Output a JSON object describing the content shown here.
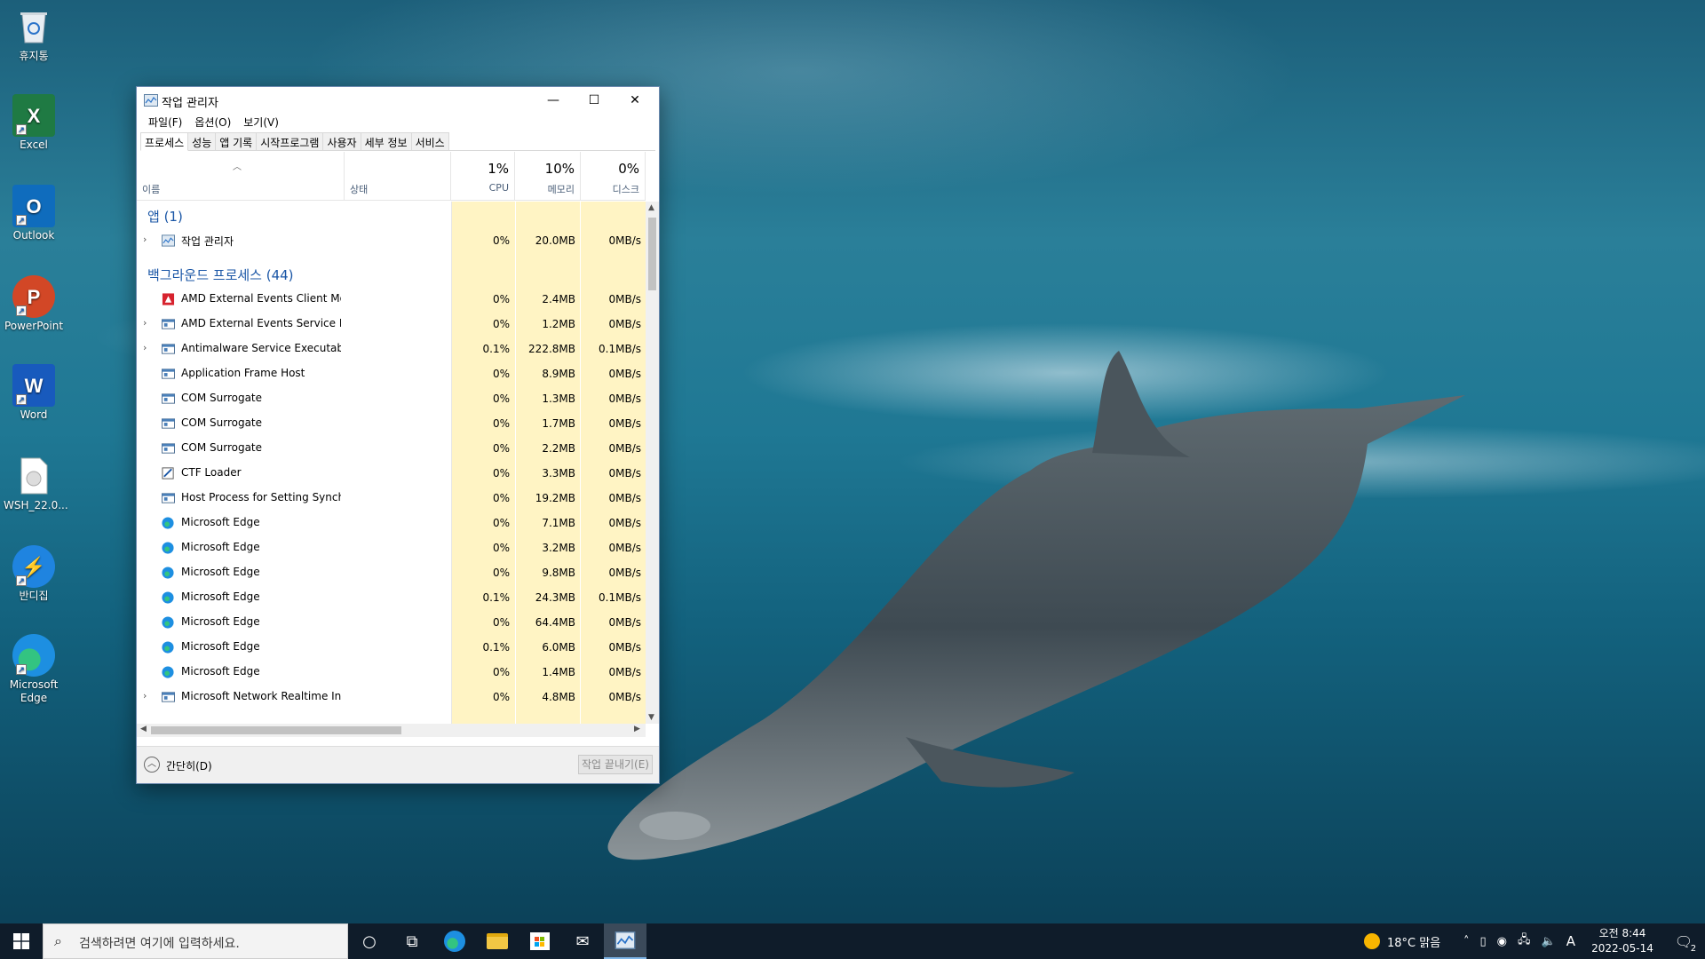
{
  "desktop": {
    "icons": [
      {
        "label": "휴지통",
        "name": "recycle-bin"
      },
      {
        "label": "Excel",
        "name": "excel"
      },
      {
        "label": "Outlook",
        "name": "outlook"
      },
      {
        "label": "PowerPoint",
        "name": "powerpoint"
      },
      {
        "label": "Word",
        "name": "word"
      },
      {
        "label": "WSH_22.0...",
        "name": "wsh-file"
      },
      {
        "label": "반디집",
        "name": "bandizip"
      },
      {
        "label": "Microsoft Edge",
        "name": "edge"
      }
    ]
  },
  "window": {
    "title": "작업 관리자",
    "controls": {
      "minimize": "—",
      "maximize": "☐",
      "close": "✕"
    },
    "menu": [
      "파일(F)",
      "옵션(O)",
      "보기(V)"
    ],
    "tabs": [
      "프로세스",
      "성능",
      "앱 기록",
      "시작프로그램",
      "사용자",
      "세부 정보",
      "서비스"
    ],
    "active_tab": "프로세스",
    "columns": {
      "name": "이름",
      "status": "상태",
      "cpu": {
        "percent": "1%",
        "label": "CPU"
      },
      "memory": {
        "percent": "10%",
        "label": "메모리"
      },
      "disk": {
        "percent": "0%",
        "label": "디스크"
      }
    },
    "groups": {
      "apps": "앱 (1)",
      "background": "백그라운드 프로세스 (44)"
    },
    "app_rows": [
      {
        "name": "작업 관리자",
        "cpu": "0%",
        "mem": "20.0MB",
        "disk": "0MB/s",
        "expandable": true,
        "icon": "task-manager-icon"
      }
    ],
    "background_rows": [
      {
        "name": "AMD External Events Client Mo...",
        "cpu": "0%",
        "mem": "2.4MB",
        "disk": "0MB/s",
        "expandable": false,
        "icon": "amd-icon"
      },
      {
        "name": "AMD External Events Service M...",
        "cpu": "0%",
        "mem": "1.2MB",
        "disk": "0MB/s",
        "expandable": true,
        "icon": "service-icon"
      },
      {
        "name": "Antimalware Service Executable",
        "cpu": "0.1%",
        "mem": "222.8MB",
        "disk": "0.1MB/s",
        "expandable": true,
        "icon": "service-icon"
      },
      {
        "name": "Application Frame Host",
        "cpu": "0%",
        "mem": "8.9MB",
        "disk": "0MB/s",
        "expandable": false,
        "icon": "service-icon"
      },
      {
        "name": "COM Surrogate",
        "cpu": "0%",
        "mem": "1.3MB",
        "disk": "0MB/s",
        "expandable": false,
        "icon": "service-icon"
      },
      {
        "name": "COM Surrogate",
        "cpu": "0%",
        "mem": "1.7MB",
        "disk": "0MB/s",
        "expandable": false,
        "icon": "service-icon"
      },
      {
        "name": "COM Surrogate",
        "cpu": "0%",
        "mem": "2.2MB",
        "disk": "0MB/s",
        "expandable": false,
        "icon": "service-icon"
      },
      {
        "name": "CTF Loader",
        "cpu": "0%",
        "mem": "3.3MB",
        "disk": "0MB/s",
        "expandable": false,
        "icon": "ctf-icon"
      },
      {
        "name": "Host Process for Setting Synch...",
        "cpu": "0%",
        "mem": "19.2MB",
        "disk": "0MB/s",
        "expandable": false,
        "icon": "service-icon"
      },
      {
        "name": "Microsoft Edge",
        "cpu": "0%",
        "mem": "7.1MB",
        "disk": "0MB/s",
        "expandable": false,
        "icon": "edge-icon"
      },
      {
        "name": "Microsoft Edge",
        "cpu": "0%",
        "mem": "3.2MB",
        "disk": "0MB/s",
        "expandable": false,
        "icon": "edge-icon"
      },
      {
        "name": "Microsoft Edge",
        "cpu": "0%",
        "mem": "9.8MB",
        "disk": "0MB/s",
        "expandable": false,
        "icon": "edge-icon"
      },
      {
        "name": "Microsoft Edge",
        "cpu": "0.1%",
        "mem": "24.3MB",
        "disk": "0.1MB/s",
        "expandable": false,
        "icon": "edge-icon"
      },
      {
        "name": "Microsoft Edge",
        "cpu": "0%",
        "mem": "64.4MB",
        "disk": "0MB/s",
        "expandable": false,
        "icon": "edge-icon"
      },
      {
        "name": "Microsoft Edge",
        "cpu": "0.1%",
        "mem": "6.0MB",
        "disk": "0MB/s",
        "expandable": false,
        "icon": "edge-icon"
      },
      {
        "name": "Microsoft Edge",
        "cpu": "0%",
        "mem": "1.4MB",
        "disk": "0MB/s",
        "expandable": false,
        "icon": "edge-icon"
      },
      {
        "name": "Microsoft Network Realtime Ins...",
        "cpu": "0%",
        "mem": "4.8MB",
        "disk": "0MB/s",
        "expandable": true,
        "icon": "service-icon"
      }
    ],
    "footer": {
      "collapse": "간단히(D)",
      "end_task": "작업 끝내기(E)"
    }
  },
  "taskbar": {
    "search_placeholder": "검색하려면 여기에 입력하세요.",
    "weather": "18°C  맑음",
    "ime": "A",
    "time": "오전 8:44",
    "date": "2022-05-14",
    "notifications": "2"
  },
  "colors": {
    "accent": "#1a56a6",
    "heat": "#fff4c4",
    "taskbar": "#0f1c2a"
  }
}
